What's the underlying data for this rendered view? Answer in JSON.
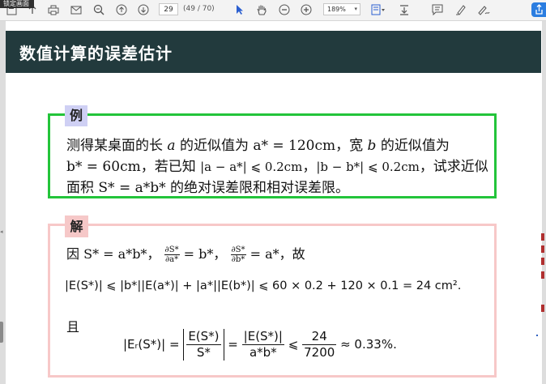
{
  "toolbar": {
    "tooltip": "锁定画面",
    "page_value": "29",
    "page_count": "(49 / 70)",
    "zoom": "189%",
    "icons": [
      "save-icon",
      "print-icon",
      "mail-icon",
      "zoom-out-search-icon",
      "page-up-icon",
      "page-down-icon",
      "select-cursor-icon",
      "hand-icon",
      "zoom-out-icon",
      "zoom-in-icon",
      "fit-page-icon",
      "download-icon",
      "comment-icon",
      "highlight-pen-icon",
      "sign-icon",
      "share-icon"
    ]
  },
  "slide": {
    "title": "数值计算的误差估计"
  },
  "example": {
    "tag": "例",
    "l1_a": "测得某桌面的长",
    "l1_var_a": "a",
    "l1_b": "的近似值为",
    "l1_astar": "a* = 120cm",
    "l1_c": "，宽",
    "l1_var_b": "b",
    "l1_d": "的近似值为",
    "l2_bstar": "b* = 60cm",
    "l2_a": "，若已知",
    "l2_cond1": "|a − a*| ⩽ 0.2cm",
    "l2_comma": "，",
    "l2_cond2": "|b − b*| ⩽ 0.2cm",
    "l2_b": "，试求近似",
    "l3_a": "面积",
    "l3_formula": "S* = a*b*",
    "l3_b": "的绝对误差限和相对误差限。"
  },
  "solution": {
    "tag": "解",
    "l1_because": "因",
    "l1_s": "S* = a*b*",
    "l1_sep": "，",
    "d1_num": "∂S*",
    "d1_den": "∂a*",
    "d1_val": "= b*",
    "d2_num": "∂S*",
    "d2_den": "∂b*",
    "d2_val": "= a*",
    "l1_so": "，故",
    "l2_formula": "|E(S*)| ⩽ |b*||E(a*)| + |a*||E(b*)| ⩽ 60 × 0.2 + 120 × 0.1 = 24 cm²",
    "l2_end": ".",
    "l3_and": "且",
    "l4_lhs": "|Eᵣ(S*)| =",
    "f1_num": "E(S*)",
    "f1_den": "S*",
    "eq": "=",
    "f2_num": "|E(S*)|",
    "f2_den": "a*b*",
    "le": "⩽",
    "f3_num": "24",
    "f3_den": "7200",
    "approx": "≈ 0.33%."
  },
  "colors": {
    "header_bg": "#223a3d",
    "example_border": "#23c43a",
    "example_tag": "#cfd0f4",
    "solution_border": "#f7c8c8",
    "solution_tag": "#f6c8c8",
    "accent_blue": "#2b7de0"
  }
}
